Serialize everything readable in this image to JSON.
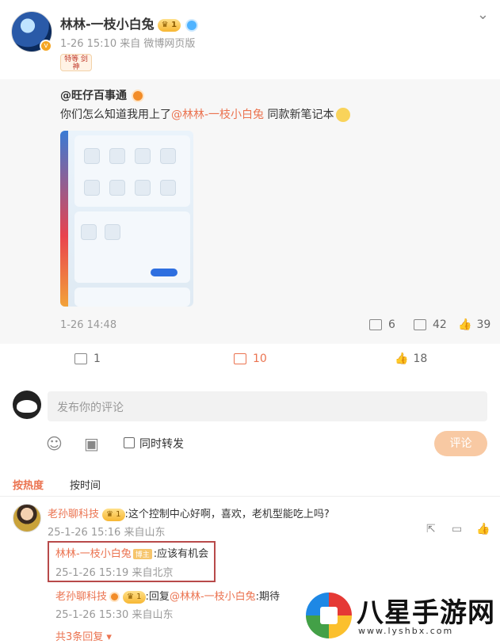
{
  "post": {
    "author": "林林-一枝小白兔",
    "vip_level": "1",
    "meta": "1-26 15:10 来自 微博网页版",
    "sticker": "特等 剑神"
  },
  "repost": {
    "name": "@旺仔百事通",
    "text_before": "你们怎么知道我用上了",
    "mention": "@林林-一枝小白兔",
    "text_after": " 同款新笔记本",
    "time": "1-26 14:48",
    "repost_count": "6",
    "comment_count": "42",
    "like_count": "39"
  },
  "actions": {
    "repost_count": "1",
    "comment_count": "10",
    "like_count": "18"
  },
  "composer": {
    "placeholder": "发布你的评论",
    "checkbox_label": "同时转发",
    "submit_label": "评论"
  },
  "sort": {
    "hot": "按热度",
    "time": "按时间"
  },
  "comments": [
    {
      "author": "老孙聊科技",
      "vip_level": "1",
      "text": ":这个控制中心好啊，喜欢，老机型能吃上吗?",
      "meta": "25-1-26 15:16 来自山东",
      "replies": [
        {
          "author": "林林-一枝小白兔",
          "tag": "博主",
          "text": ":应该有机会",
          "meta": "25-1-26 15:19 来自北京"
        },
        {
          "author": "老孙聊科技",
          "vip_level": "1",
          "text_prefix": ":回复",
          "mention": "@林林-一枝小白兔",
          "text": ":期待",
          "meta": "25-1-26 15:30 来自山东"
        }
      ],
      "more_replies": "共3条回复"
    }
  ],
  "watermark": {
    "text": "八星手游网",
    "url": "www.lyshbx.com"
  },
  "colors": {
    "accent": "#eb7350",
    "comment_button": "#f8c9a3",
    "highlight_border": "#b84a4a"
  }
}
